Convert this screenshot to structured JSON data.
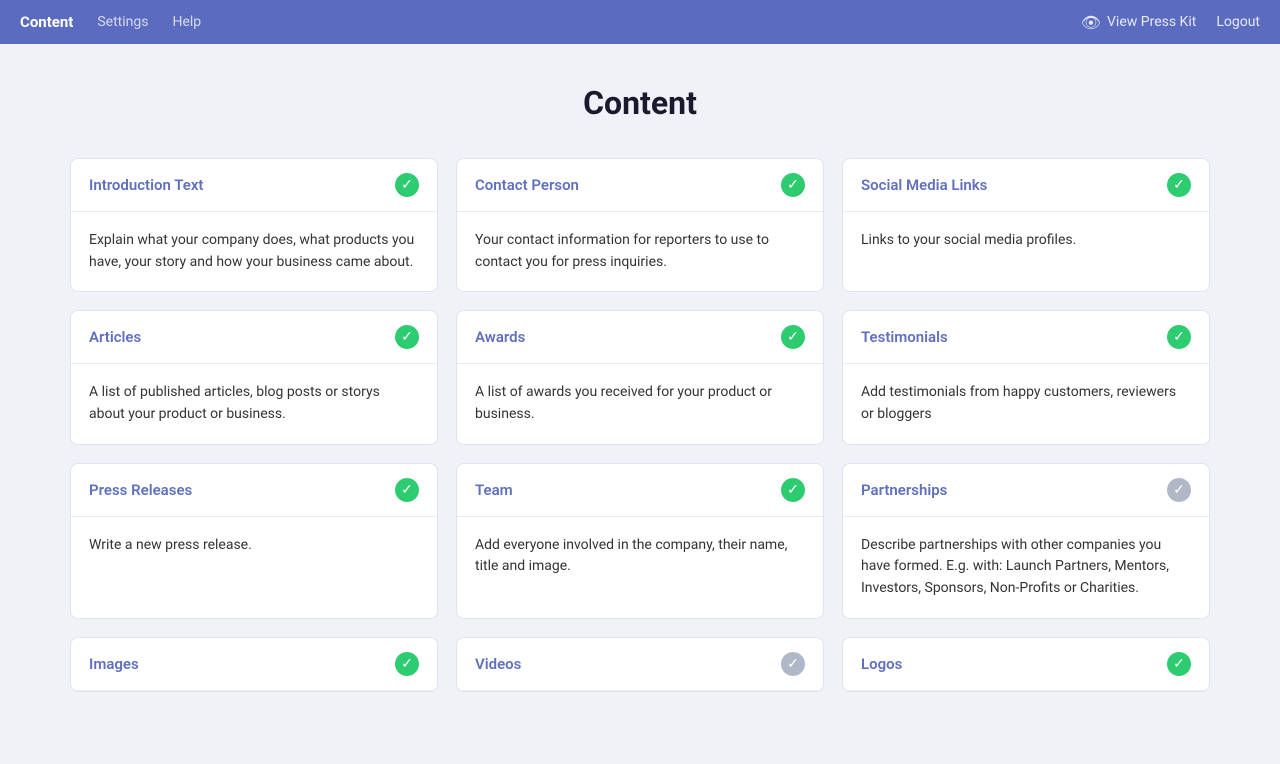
{
  "nav": {
    "brand": "Content",
    "links": [
      "Settings",
      "Help"
    ],
    "right": {
      "view_label": "View Press Kit",
      "logout_label": "Logout"
    }
  },
  "page": {
    "title": "Content"
  },
  "cards": [
    {
      "id": "introduction-text",
      "title": "Introduction Text",
      "description": "Explain what your company does, what products you have, your story and how your business came about.",
      "status": "green"
    },
    {
      "id": "contact-person",
      "title": "Contact Person",
      "description": "Your contact information for reporters to use to contact you for press inquiries.",
      "status": "green"
    },
    {
      "id": "social-media-links",
      "title": "Social Media Links",
      "description": "Links to your social media profiles.",
      "status": "green"
    },
    {
      "id": "articles",
      "title": "Articles",
      "description": "A list of published articles, blog posts or storys about your product or business.",
      "status": "green"
    },
    {
      "id": "awards",
      "title": "Awards",
      "description": "A list of awards you received for your product or business.",
      "status": "green"
    },
    {
      "id": "testimonials",
      "title": "Testimonials",
      "description": "Add testimonials from happy customers, reviewers or bloggers",
      "status": "green"
    },
    {
      "id": "press-releases",
      "title": "Press Releases",
      "description": "Write a new press release.",
      "status": "green"
    },
    {
      "id": "team",
      "title": "Team",
      "description": "Add everyone involved in the company, their name, title and image.",
      "status": "green"
    },
    {
      "id": "partnerships",
      "title": "Partnerships",
      "description": "Describe partnerships with other companies you have formed. E.g. with: Launch Partners, Mentors, Investors, Sponsors, Non-Profits or Charities.",
      "status": "gray"
    },
    {
      "id": "images",
      "title": "Images",
      "description": "",
      "status": "green"
    },
    {
      "id": "videos",
      "title": "Videos",
      "description": "",
      "status": "gray"
    },
    {
      "id": "logos",
      "title": "Logos",
      "description": "",
      "status": "green"
    }
  ]
}
